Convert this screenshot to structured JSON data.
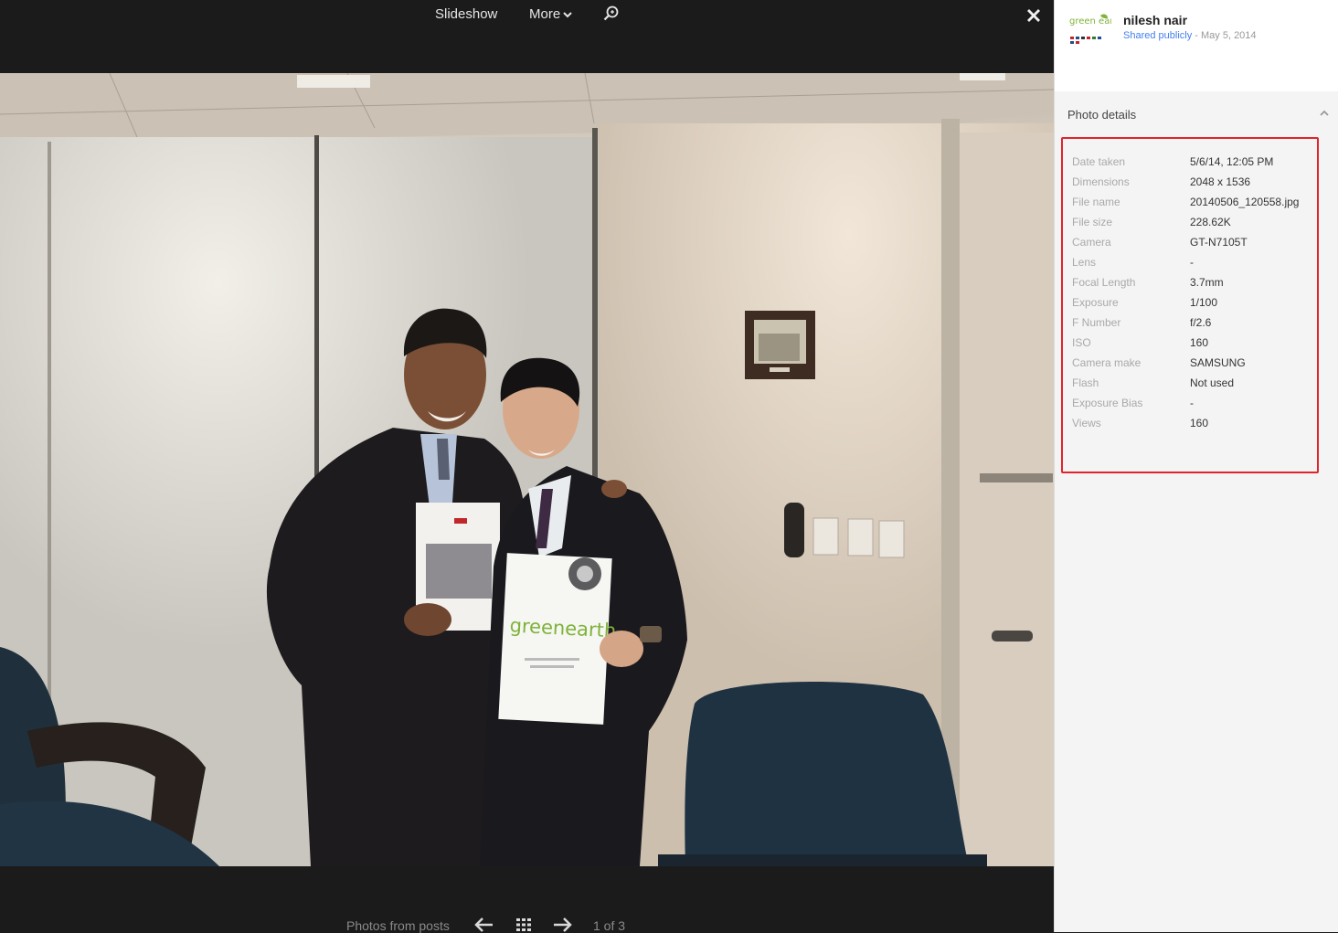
{
  "toolbar": {
    "slideshow_label": "Slideshow",
    "more_label": "More",
    "zoom_icon": "zoom-search-icon",
    "close_icon": "close-icon"
  },
  "bottom": {
    "label": "Photos from posts",
    "counter": "1 of 3",
    "prev_icon": "arrow-left-icon",
    "grid_icon": "grid-icon",
    "next_icon": "arrow-right-icon"
  },
  "photo": {
    "brochure_brand": "greenearth"
  },
  "post": {
    "author": "nilesh nair",
    "share_label": "Shared publicly",
    "date": "- May 5, 2014",
    "avatar_text": "green earth"
  },
  "details": {
    "title": "Photo details",
    "rows": [
      {
        "label": "Date taken",
        "value": "5/6/14, 12:05 PM"
      },
      {
        "label": "Dimensions",
        "value": "2048 x 1536"
      },
      {
        "label": "File name",
        "value": "20140506_120558.jpg"
      },
      {
        "label": "File size",
        "value": "228.62K"
      },
      {
        "label": "Camera",
        "value": "GT-N7105T"
      },
      {
        "label": "Lens",
        "value": "-"
      },
      {
        "label": "Focal Length",
        "value": "3.7mm"
      },
      {
        "label": "Exposure",
        "value": "1/100"
      },
      {
        "label": "F Number",
        "value": "f/2.6"
      },
      {
        "label": "ISO",
        "value": "160"
      },
      {
        "label": "Camera make",
        "value": "SAMSUNG"
      },
      {
        "label": "Flash",
        "value": "Not used"
      },
      {
        "label": "Exposure Bias",
        "value": "-"
      },
      {
        "label": "Views",
        "value": "160"
      }
    ]
  },
  "colors": {
    "viewer_bg": "#1b1b1b",
    "panel_bg": "#f4f4f4",
    "link": "#427fed",
    "highlight_border": "#e0242b"
  }
}
